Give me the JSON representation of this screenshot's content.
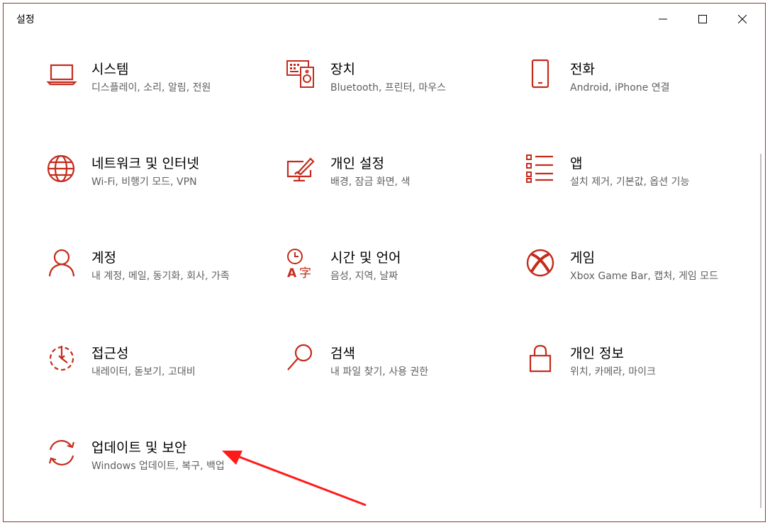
{
  "window": {
    "title": "설정",
    "controls": {
      "minimize": "minimize-icon",
      "maximize": "maximize-icon",
      "close": "close-icon"
    }
  },
  "accent_color": "#c42b1c",
  "tiles": [
    {
      "name": "시스템",
      "desc": "디스플레이, 소리, 알림, 전원",
      "icon": "laptop-icon"
    },
    {
      "name": "장치",
      "desc": "Bluetooth, 프린터, 마우스",
      "icon": "keyboard-speaker-icon"
    },
    {
      "name": "전화",
      "desc": "Android, iPhone 연결",
      "icon": "phone-icon"
    },
    {
      "name": "네트워크 및 인터넷",
      "desc": "Wi-Fi, 비행기 모드, VPN",
      "icon": "globe-icon"
    },
    {
      "name": "개인 설정",
      "desc": "배경, 잠금 화면, 색",
      "icon": "paint-icon"
    },
    {
      "name": "앱",
      "desc": "설치 제거, 기본값, 옵션 기능",
      "icon": "apps-list-icon"
    },
    {
      "name": "계정",
      "desc": "내 계정, 메일, 동기화, 회사, 가족",
      "icon": "person-icon"
    },
    {
      "name": "시간 및 언어",
      "desc": "음성, 지역, 날짜",
      "icon": "time-language-icon"
    },
    {
      "name": "게임",
      "desc": "Xbox Game Bar, 캡처, 게임 모드",
      "icon": "xbox-icon"
    },
    {
      "name": "접근성",
      "desc": "내레이터, 돋보기, 고대비",
      "icon": "accessibility-icon"
    },
    {
      "name": "검색",
      "desc": "내 파일 찾기, 사용 권한",
      "icon": "search-icon"
    },
    {
      "name": "개인 정보",
      "desc": "위치, 카메라, 마이크",
      "icon": "lock-icon"
    },
    {
      "name": "업데이트 및 보안",
      "desc": "Windows 업데이트, 복구, 백업",
      "icon": "sync-icon"
    }
  ]
}
